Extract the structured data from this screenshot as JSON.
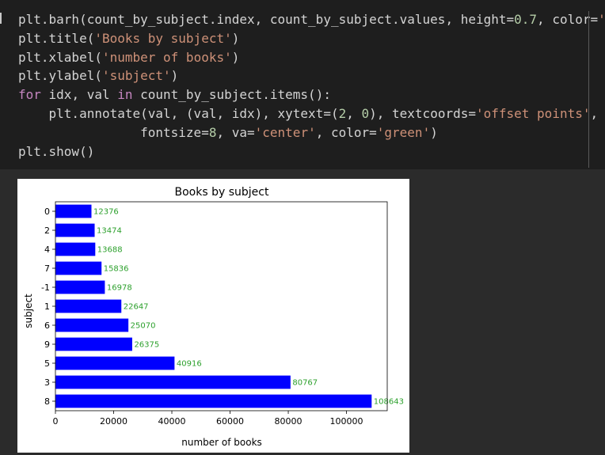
{
  "code_cell": {
    "lines": [
      [
        {
          "t": "plt.barh(count_by_subject.index, count_by_subject.values, height=",
          "c": "fn"
        },
        {
          "t": "0.7",
          "c": "num"
        },
        {
          "t": ", color=",
          "c": "fn"
        },
        {
          "t": "'blue'",
          "c": "str"
        },
        {
          "t": ")",
          "c": "fn"
        }
      ],
      [
        {
          "t": "plt.title(",
          "c": "fn"
        },
        {
          "t": "'Books by subject'",
          "c": "str"
        },
        {
          "t": ")",
          "c": "fn"
        }
      ],
      [
        {
          "t": "plt.xlabel(",
          "c": "fn"
        },
        {
          "t": "'number of books'",
          "c": "str"
        },
        {
          "t": ")",
          "c": "fn"
        }
      ],
      [
        {
          "t": "plt.ylabel(",
          "c": "fn"
        },
        {
          "t": "'subject'",
          "c": "str"
        },
        {
          "t": ")",
          "c": "fn"
        }
      ],
      [
        {
          "t": "for",
          "c": "kw"
        },
        {
          "t": " idx, val ",
          "c": "fn"
        },
        {
          "t": "in",
          "c": "kw"
        },
        {
          "t": " count_by_subject.items():",
          "c": "fn"
        }
      ],
      [
        {
          "t": "    plt.annotate(val, (val, idx), xytext=(",
          "c": "fn"
        },
        {
          "t": "2",
          "c": "num"
        },
        {
          "t": ", ",
          "c": "fn"
        },
        {
          "t": "0",
          "c": "num"
        },
        {
          "t": "), textcoords=",
          "c": "fn"
        },
        {
          "t": "'offset points'",
          "c": "str"
        },
        {
          "t": ",",
          "c": "fn"
        }
      ],
      [
        {
          "t": "                fontsize=",
          "c": "fn"
        },
        {
          "t": "8",
          "c": "num"
        },
        {
          "t": ", va=",
          "c": "fn"
        },
        {
          "t": "'center'",
          "c": "str"
        },
        {
          "t": ", color=",
          "c": "fn"
        },
        {
          "t": "'green'",
          "c": "str"
        },
        {
          "t": ")",
          "c": "fn"
        }
      ],
      [
        {
          "t": "plt.show()",
          "c": "fn"
        }
      ]
    ]
  },
  "chart_data": {
    "type": "bar",
    "orientation": "horizontal",
    "title": "Books by subject",
    "xlabel": "number of books",
    "ylabel": "subject",
    "categories": [
      "0",
      "2",
      "4",
      "7",
      "-1",
      "1",
      "6",
      "9",
      "5",
      "3",
      "8"
    ],
    "values": [
      12376,
      13474,
      13688,
      15836,
      16978,
      22647,
      25070,
      26375,
      40916,
      80767,
      108643
    ],
    "xlim": [
      0,
      114000
    ],
    "xticks": [
      0,
      20000,
      40000,
      60000,
      80000,
      100000
    ],
    "bar_color": "#0000ff",
    "annotation_color": "#2ca02c",
    "grid": false
  }
}
